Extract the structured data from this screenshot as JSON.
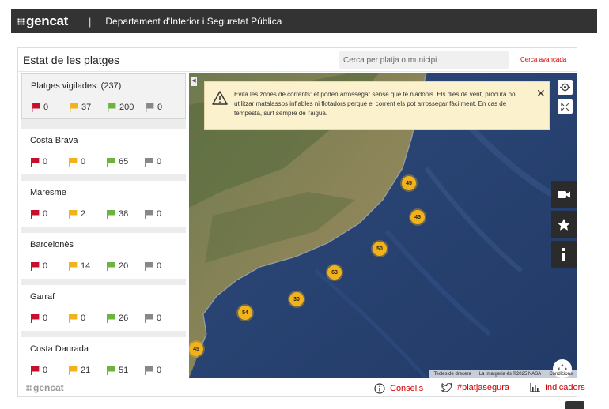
{
  "header": {
    "logo_text": "gencat",
    "separator": "|",
    "department": "Departament d'Interior i Seguretat Pública"
  },
  "panel": {
    "title": "Estat de les platges",
    "search_placeholder": "Cerca per platja o municipi",
    "advanced_search": "Cerca avançada"
  },
  "flag_colors": {
    "red": "#c8102e",
    "yellow": "#f2b31a",
    "green": "#6cb33f",
    "grey": "#888888"
  },
  "regions": [
    {
      "name": "Platges vigilades: (237)",
      "red": "0",
      "yellow": "37",
      "green": "200",
      "grey": "0"
    },
    {
      "name": "Costa Brava",
      "red": "0",
      "yellow": "0",
      "green": "65",
      "grey": "0"
    },
    {
      "name": "Maresme",
      "red": "0",
      "yellow": "2",
      "green": "38",
      "grey": "0"
    },
    {
      "name": "Barcelonès",
      "red": "0",
      "yellow": "14",
      "green": "20",
      "grey": "0"
    },
    {
      "name": "Garraf",
      "red": "0",
      "yellow": "0",
      "green": "26",
      "grey": "0"
    },
    {
      "name": "Costa Daurada",
      "red": "0",
      "yellow": "21",
      "green": "51",
      "grey": "0"
    }
  ],
  "warning": {
    "text": "Evita les zones de corrents: et poden arrossegar sense que te n'adonis. Els dies de vent, procura no utilitzar matalassos inflables ni flotadors perquè el corrent els pot arrossegar fàcilment. En cas de tempesta, surt sempre de l'aigua.",
    "close": "✕"
  },
  "clusters": [
    "45",
    "45",
    "50",
    "63",
    "30",
    "54",
    "45"
  ],
  "map_attribution": {
    "shortcuts": "Tecles de drecera",
    "imagery": "La imatgeria és ©2025 NASA",
    "terms": "Condicions"
  },
  "map_controls": [
    "locate-icon",
    "fullscreen-icon",
    "camera-icon",
    "star-icon",
    "info-icon",
    "recenter-icon"
  ],
  "footer": {
    "logo_text": "gencat",
    "links": [
      {
        "label": "Consells",
        "icon": "info-circle-icon"
      },
      {
        "label": "#platjasegura",
        "icon": "twitter-icon"
      },
      {
        "label": "Indicadors",
        "icon": "bar-chart-icon"
      }
    ]
  }
}
